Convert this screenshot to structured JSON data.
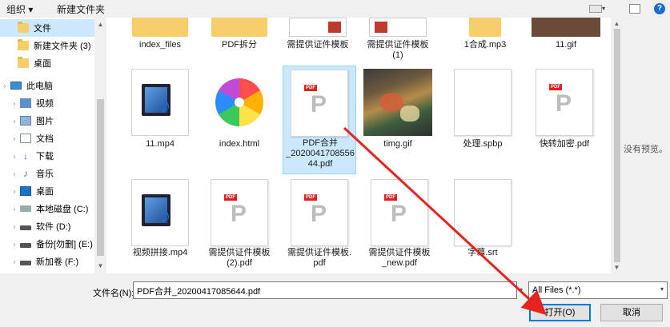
{
  "toolbar": {
    "organize_label": "组织 ▾",
    "new_folder_label": "新建文件夹",
    "help_label": "?"
  },
  "nav": {
    "items": [
      {
        "label": "文件",
        "icon": "folder-icon"
      },
      {
        "label": "新建文件夹 (3)",
        "icon": "folder-icon"
      },
      {
        "label": "桌面",
        "icon": "folder-icon"
      },
      {
        "label": "此电脑",
        "icon": "computer-icon"
      },
      {
        "label": "视频",
        "icon": "video-icon"
      },
      {
        "label": "图片",
        "icon": "pictures-icon"
      },
      {
        "label": "文档",
        "icon": "documents-icon"
      },
      {
        "label": "下载",
        "icon": "download-icon"
      },
      {
        "label": "音乐",
        "icon": "music-icon"
      },
      {
        "label": "桌面",
        "icon": "desktop-icon"
      },
      {
        "label": "本地磁盘 (C:)",
        "icon": "drive-icon"
      },
      {
        "label": "软件 (D:)",
        "icon": "drive-icon"
      },
      {
        "label": "备份[勿删] (E:)",
        "icon": "drive-icon"
      },
      {
        "label": "新加卷 (F:)",
        "icon": "drive-icon"
      }
    ]
  },
  "files": {
    "row0": [
      {
        "label": "index_files",
        "type": "folder"
      },
      {
        "label": "PDF拆分",
        "type": "folder"
      },
      {
        "label": "需提供证件模板",
        "type": "folder"
      },
      {
        "label": "需提供证件模板\n(1)",
        "type": "folder"
      },
      {
        "label": "1合成.mp3",
        "type": "folder"
      },
      {
        "label": "11.gif",
        "type": "image"
      }
    ],
    "row1": [
      {
        "label": "11.mp4",
        "type": "video"
      },
      {
        "label": "index.html",
        "type": "html"
      },
      {
        "label": "PDF合并\n_2020041708556\n44.pdf",
        "type": "pdf",
        "selected": true
      },
      {
        "label": "timg.gif",
        "type": "image"
      },
      {
        "label": "处理.spbp",
        "type": "blank"
      },
      {
        "label": "快转加密.pdf",
        "type": "pdf"
      }
    ],
    "row2": [
      {
        "label": "视频拼接.mp4",
        "type": "video"
      },
      {
        "label": "需提供证件模板\n(2).pdf",
        "type": "pdf"
      },
      {
        "label": "需提供证件模板.\npdf",
        "type": "pdf"
      },
      {
        "label": "需提供证件模板\n_new.pdf",
        "type": "pdf"
      },
      {
        "label": "字幕.srt",
        "type": "blank"
      }
    ]
  },
  "preview": {
    "empty_text": "没有预览。"
  },
  "footer": {
    "filename_label": "文件名(N):",
    "filename_value": "PDF合并_20200417085644.pdf",
    "filter_value": "All Files (*.*)",
    "open_label": "打开(O)",
    "cancel_label": "取消"
  },
  "annotation": {
    "arrow_color": "#e8231f"
  }
}
